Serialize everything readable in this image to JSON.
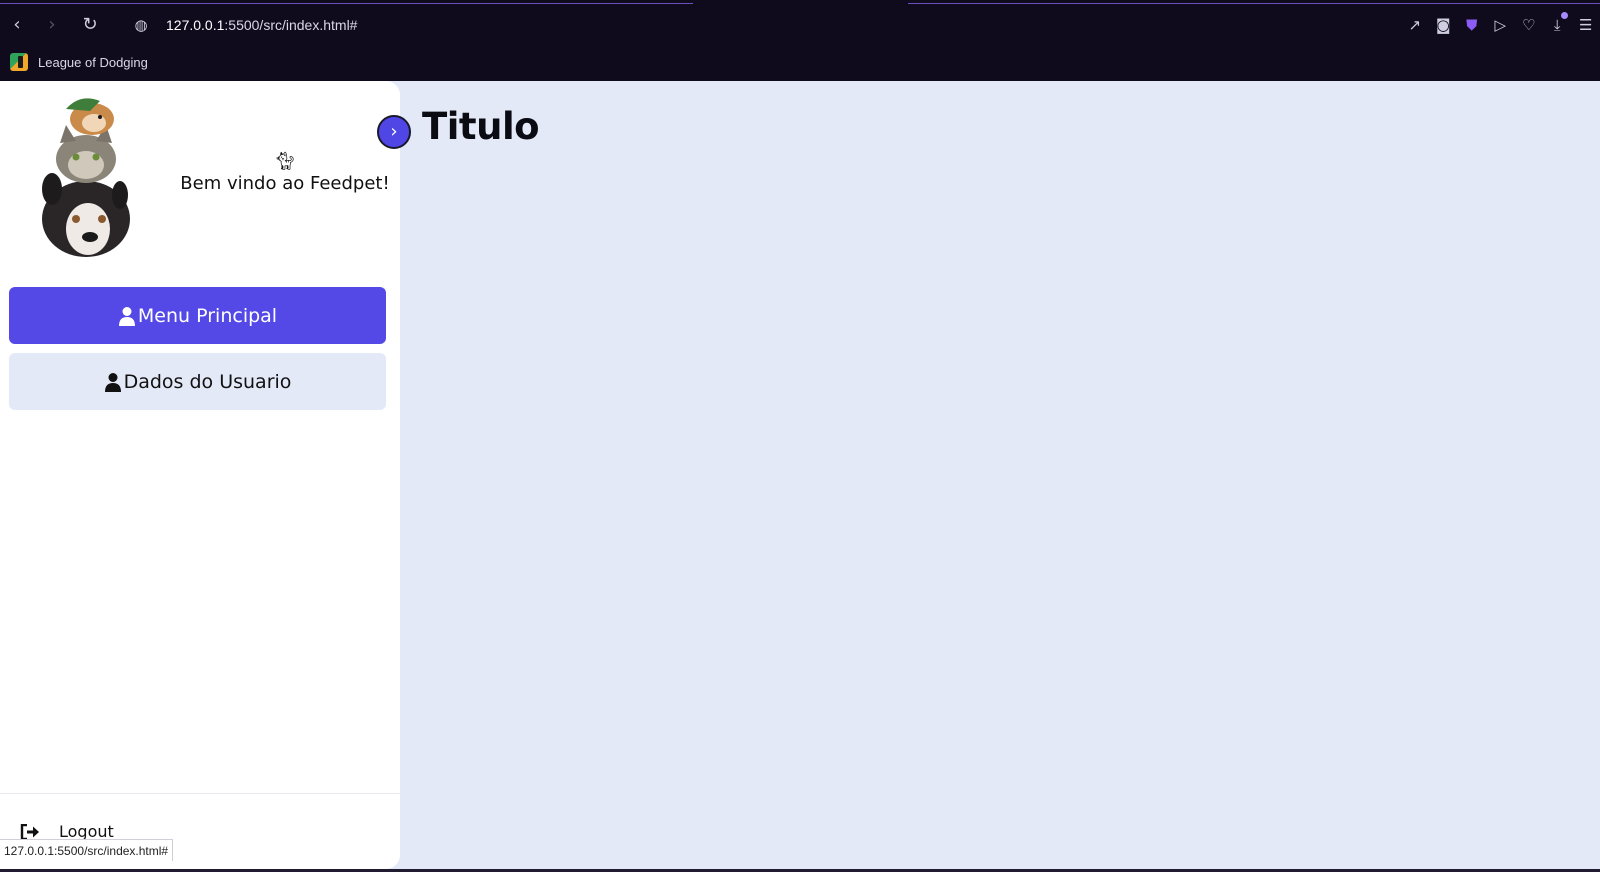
{
  "browser": {
    "url_host": "127.0.0.1",
    "url_rest": ":5500/src/index.html#",
    "bookmark_label": "League of Dodging"
  },
  "sidebar": {
    "welcome_icon": "cat-icon",
    "welcome_text": "Bem vindo ao Feedpet!",
    "items": [
      {
        "label": "Menu Principal",
        "icon": "user-icon",
        "active": true
      },
      {
        "label": "Dados do Usuario",
        "icon": "user-icon",
        "active": false
      }
    ],
    "logout_label": "Logout",
    "toggle_icon": "chevron-right-icon"
  },
  "main": {
    "title": "Titulo"
  },
  "status_bar": {
    "url": "127.0.0.1:5500/src/index.html#"
  },
  "colors": {
    "accent": "#5449e6",
    "page_background": "#e4e9f7",
    "chrome_background": "#0f0b1d"
  }
}
